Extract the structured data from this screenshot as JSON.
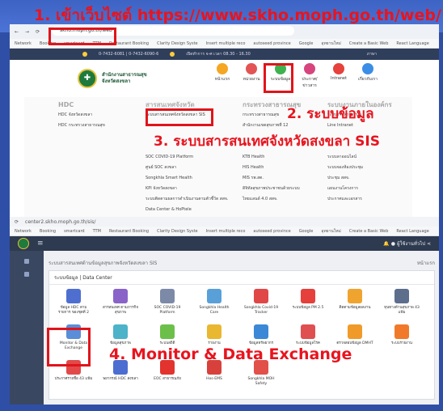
{
  "captions": {
    "step1": "1. เข้าเว็บไซต์ https://www.skho.moph.go.th/web/",
    "step2": "2. ระบบข้อมูล",
    "step3": "3. ระบบสารสนเทศจังหวัดสงขลา SIS",
    "step4": "4. Monitor & Data Exchange"
  },
  "browser1": {
    "url": "skho.moph.go.th/web",
    "bookmarks": [
      "Network",
      "Booking",
      "smartcard",
      "TTM",
      "Restaurant Booking",
      "Clarity Design Syste",
      "Insert multiple reco",
      "autoseed province",
      "Google",
      "อุทยานใหม่",
      "Create a Basic Web",
      "React Language"
    ],
    "info_phone": "0-7432-6081 | 0-7432-6090-6",
    "info_hours": "เปิดทำการ จ-ศ เวลา 08.30 - 16.30",
    "info_lang": "ภาษา",
    "org_name_1": "สำนักงานสาธารณสุข",
    "org_name_2": "จังหวัดสงขลา",
    "nav": [
      {
        "label": "หน้าแรก",
        "color": "#f5a623"
      },
      {
        "label": "หน่วยงาน",
        "color": "#e35454"
      },
      {
        "label": "ระบบข้อมูล",
        "color": "#3fb24f"
      },
      {
        "label": "ประกาศ/ข่าวสาร",
        "color": "#d6457d"
      },
      {
        "label": "Intranet",
        "color": "#e6413c"
      },
      {
        "label": "เกี่ยวกับเรา",
        "color": "#3a8ee6"
      }
    ],
    "menu": {
      "col1_head": "HDC",
      "col1": [
        "HDC จังหวัดสงขลา",
        "HDC กระทรวงสาธารณสุข"
      ],
      "col2_head": "สารสนเทศจังหวัด",
      "col2": [
        "ระบบสารสนเทศจังหวัดสงขลา SIS",
        "",
        "",
        "",
        "SOC COVID-19 Platform",
        "ศูนย์ SOC สงขลา",
        "Songkhla Smart Health",
        "KPI จังหวัดสงขลา",
        "ระบบติดตามผลการดำเนินงานตามตัวชี้วัด สสจ.",
        "Data Center & HoPtele"
      ],
      "col3_head": "กระทรวงสาธารณสุข",
      "col3": [
        "กระทรวงสาธารณสุข",
        "สำนักงานเขตสุขภาพที่ 12",
        "",
        "",
        "KTB Health",
        "HIS Health",
        "MIS รพ.สต.",
        "ดิจิทัลสุขภาพประชาชนด้วยระบบ",
        "ไทยแลนด์ 4.0 สสจ."
      ],
      "col4_head": "ระบบงานภายในองค์กร",
      "col4": [
        "ระบบงานสารบรรณ",
        "Line Intranet",
        "",
        "",
        "ระบบลาออนไลน์",
        "ระบบจองห้องประชุม",
        "ประชุม สสจ.",
        "แผนงานโครงการ",
        "ประกาศและเอกสาร"
      ]
    }
  },
  "browser2": {
    "url": "center2.skho.moph.go.th/sis/",
    "user": "ผู้ใช้งานทั่วไป",
    "breadcrumb": "ระบบสารสนเทศด้านข้อมูลสุขภาพจังหวัดสงขลา SIS",
    "breadcrumb_right": "หน้าแรก",
    "card_title": "ระบบข้อมูล | Data Center",
    "tiles": [
      {
        "label": "ข้อมูล HDC ตามรายการ ของชุดที่ 2",
        "color": "#4f6fd0"
      },
      {
        "label": "สารสนเทศ ตามภารกิจสุขภาพ",
        "color": "#8a63c9"
      },
      {
        "label": "SOC COVID-19 Platform",
        "color": "#7c8aa8"
      },
      {
        "label": "Songkhla Health Care",
        "color": "#5aa0d8"
      },
      {
        "label": "Songkhla Covid-19 Tracker",
        "color": "#e04848"
      },
      {
        "label": "ระบบข้อมูล PM 2.5",
        "color": "#e5403c"
      },
      {
        "label": "ติดตามข้อมูลผลงาน",
        "color": "#f0a430"
      },
      {
        "label": "ทุนทางด้านสุขภาพ 43 แฟ้ม",
        "color": "#5d6d8c"
      },
      {
        "label": "Monitor & Data Exchange",
        "color": "#5a8ed8"
      },
      {
        "label": "ข้อมูลสุขภาพ",
        "color": "#4cb3c9"
      },
      {
        "label": "ระบบสถิติ",
        "color": "#6cc04a"
      },
      {
        "label": "รายงาน",
        "color": "#e9b730"
      },
      {
        "label": "ข้อมูลทรัพยากร",
        "color": "#3b88d6"
      },
      {
        "label": "ระบบข้อมูลโรค",
        "color": "#e05050"
      },
      {
        "label": "ตรวจสอบข้อมูล DMHT",
        "color": "#f09a2a"
      },
      {
        "label": "ระบบรายงาน",
        "color": "#f07a2a"
      },
      {
        "label": "ประกาศรายชื่อ 43 แฟ้ม",
        "color": "#e24a4a"
      },
      {
        "label": "พยากรณ์ HDC สงขลา",
        "color": "#4b6ed0"
      },
      {
        "label": "EOC สาธารณภัย",
        "color": "#e2332f"
      },
      {
        "label": "Hos-EMS",
        "color": "#d8413b"
      },
      {
        "label": "Songkhla MOH Safety",
        "color": "#e2504a"
      }
    ]
  }
}
